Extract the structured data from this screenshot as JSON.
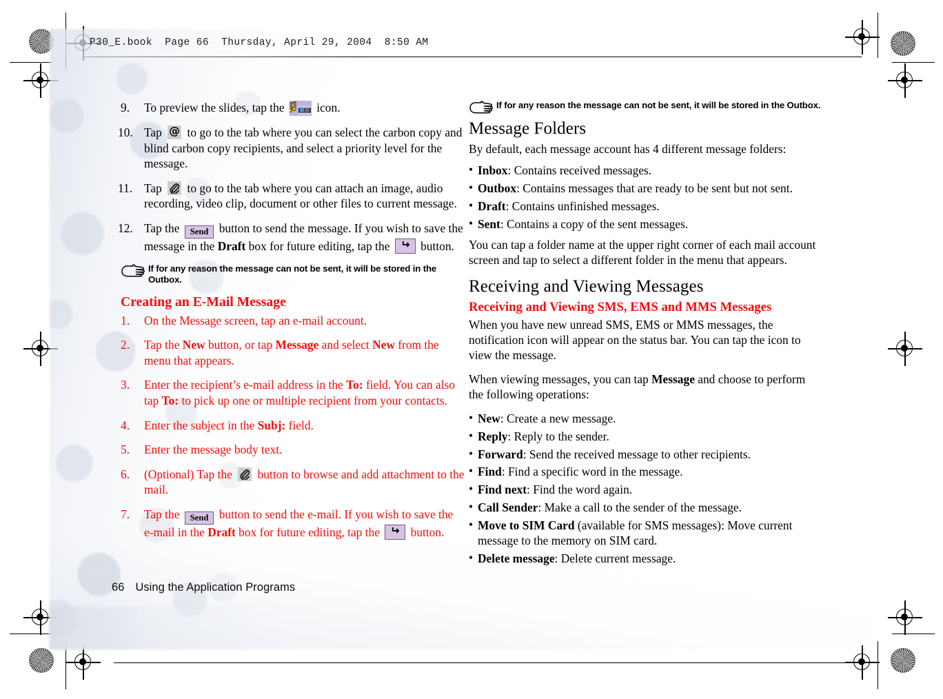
{
  "header": {
    "slug": "P30_E.book  Page 66  Thursday, April 29, 2004  8:50 AM"
  },
  "footer": {
    "page_number": "66",
    "section_title": "Using the Application Programs"
  },
  "colors": {
    "red": "#FA0A0A",
    "button_fill": "#D7C4E4",
    "button_border": "#6E5A80",
    "icon_gray": "#CFCFCF",
    "slides_icon_bg": "#BFB4DE"
  },
  "left_column": {
    "steps": [
      {
        "num": "9.",
        "parts": [
          {
            "t": "text",
            "v": "To preview the slides, tap the "
          },
          {
            "t": "icon",
            "v": "slides-preview-icon"
          },
          {
            "t": "text",
            "v": " icon."
          }
        ]
      },
      {
        "num": "10.",
        "parts": [
          {
            "t": "text",
            "v": "Tap "
          },
          {
            "t": "icon",
            "v": "at-sign-icon"
          },
          {
            "t": "text",
            "v": " to go to the tab where you can select the carbon copy and blind carbon copy recipients, and select a priority level for the message."
          }
        ]
      },
      {
        "num": "11.",
        "parts": [
          {
            "t": "text",
            "v": "Tap "
          },
          {
            "t": "icon",
            "v": "paperclip-icon"
          },
          {
            "t": "text",
            "v": " to go to the tab where you can attach an image, audio recording, video clip, document or other files to current message."
          }
        ]
      },
      {
        "num": "12.",
        "parts": [
          {
            "t": "text",
            "v": "Tap the "
          },
          {
            "t": "button",
            "v": "Send"
          },
          {
            "t": "text",
            "v": " button to send the message. If you wish to save the message in the "
          },
          {
            "t": "bold",
            "v": "Draft"
          },
          {
            "t": "text",
            "v": " box for future editing, tap the "
          },
          {
            "t": "button",
            "v": "return-arrow-icon"
          },
          {
            "t": "text",
            "v": " button."
          }
        ]
      }
    ],
    "note": "If for any reason the message can not be sent, it will be stored in the Outbox.",
    "heading": "Creating an E-Mail Message",
    "email_steps": [
      {
        "num": "1.",
        "parts": [
          {
            "t": "text",
            "v": "On the Message screen, tap an e-mail account."
          }
        ]
      },
      {
        "num": "2.",
        "parts": [
          {
            "t": "text",
            "v": "Tap the "
          },
          {
            "t": "bold",
            "v": "New"
          },
          {
            "t": "text",
            "v": " button, or tap "
          },
          {
            "t": "bold",
            "v": "Message"
          },
          {
            "t": "text",
            "v": " and select "
          },
          {
            "t": "bold",
            "v": "New"
          },
          {
            "t": "text",
            "v": " from the menu that appears."
          }
        ]
      },
      {
        "num": "3.",
        "parts": [
          {
            "t": "text",
            "v": "Enter the recipient’s e-mail address in the "
          },
          {
            "t": "bold",
            "v": "To:"
          },
          {
            "t": "text",
            "v": " field. You can also tap "
          },
          {
            "t": "bold",
            "v": "To:"
          },
          {
            "t": "text",
            "v": " to pick up one or multiple recipient from your contacts."
          }
        ]
      },
      {
        "num": "4.",
        "parts": [
          {
            "t": "text",
            "v": "Enter the subject in the "
          },
          {
            "t": "bold",
            "v": "Subj:"
          },
          {
            "t": "text",
            "v": " field."
          }
        ]
      },
      {
        "num": "5.",
        "parts": [
          {
            "t": "text",
            "v": "Enter the message body text."
          }
        ]
      },
      {
        "num": "6.",
        "parts": [
          {
            "t": "text",
            "v": "(Optional) Tap the "
          },
          {
            "t": "icon",
            "v": "paperclip-icon"
          },
          {
            "t": "text",
            "v": " button to browse and add attachment to the mail."
          }
        ]
      },
      {
        "num": "7.",
        "parts": [
          {
            "t": "text",
            "v": "Tap the "
          },
          {
            "t": "button",
            "v": "Send"
          },
          {
            "t": "text",
            "v": " button to send the e-mail. If you wish to save the e-mail in the "
          },
          {
            "t": "bold",
            "v": "Draft"
          },
          {
            "t": "text",
            "v": " box for future editing, tap the "
          },
          {
            "t": "button",
            "v": "return-arrow-icon"
          },
          {
            "t": "text",
            "v": " button."
          }
        ]
      }
    ]
  },
  "right_column": {
    "note": "If for any reason the message can not be sent, it will be stored in the Outbox.",
    "message_folders": {
      "heading": "Message Folders",
      "intro": "By default, each message account has 4 different message folders:",
      "bullets": [
        {
          "term": "Inbox",
          "sep": ":",
          "desc": " Contains received messages."
        },
        {
          "term": "Outbox",
          "sep": ":",
          "desc": " Contains messages that are ready to be sent but not sent."
        },
        {
          "term": "Draft",
          "sep": ":",
          "desc": " Contains unfinished messages."
        },
        {
          "term": "Sent",
          "sep": ":",
          "desc": " Contains a copy of the sent messages."
        }
      ],
      "outro": "You can tap a folder name at the upper right corner of each mail account screen and tap to select a different folder in the menu that appears."
    },
    "receiving": {
      "heading": "Receiving and Viewing Messages",
      "subheading": "Receiving and Viewing SMS, EMS and MMS Messages",
      "para1": "When you have new unread SMS, EMS or MMS messages, the notification icon will appear on the status bar. You can tap the icon to view the message.",
      "para2_pre": "When viewing messages, you can tap ",
      "para2_bold": "Message",
      "para2_post": " and choose to perform the following operations:",
      "bullets": [
        {
          "term": "New",
          "sep": ":",
          "desc": " Create a new message."
        },
        {
          "term": "Reply",
          "sep": ":",
          "desc": " Reply to the sender."
        },
        {
          "term": "Forward",
          "sep": ":",
          "desc": " Send the received message to other recipients."
        },
        {
          "term": "Find",
          "sep": ":",
          "desc": " Find a specific word in the message."
        },
        {
          "term": "Find next",
          "sep": ":",
          "desc": " Find the word again."
        },
        {
          "term": "Call Sender",
          "sep": ":",
          "desc": " Make a call to the sender of the message."
        },
        {
          "term": "Move to SIM Card",
          "sep": "",
          "desc": " (available for SMS messages): Move current message to the memory on SIM card."
        },
        {
          "term": "Delete message",
          "sep": ":",
          "desc": " Delete current message."
        }
      ]
    }
  }
}
